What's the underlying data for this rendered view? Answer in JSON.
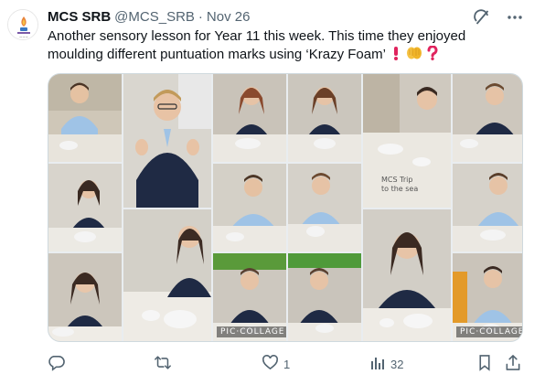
{
  "author": {
    "display_name": "MCS SRB",
    "handle": "@MCS_SRB",
    "separator": "·",
    "date": "Nov 26"
  },
  "tweet": {
    "line1": "Another sensory lesson for Year 11 this week. This time they enjoyed",
    "line2": "moulding different puntuation marks using ‘Krazy Foam’"
  },
  "media": {
    "watermark": "PIC·COLLAGE",
    "board_text": "MCS Trip to the sea",
    "photo_count": 17
  },
  "actions": {
    "reply_count": "",
    "retweet_count": "",
    "like_count": "1",
    "views_count": "32"
  },
  "icons": [
    "grok-icon",
    "more-icon",
    "reply-icon",
    "retweet-icon",
    "like-icon",
    "views-icon",
    "bookmark-icon",
    "share-icon",
    "exclamation-emoji",
    "hands-emoji",
    "question-emoji"
  ],
  "colors": {
    "text": "#0f1419",
    "secondary": "#536471",
    "border": "#cfd9de",
    "uniform_navy": "#1f2a44",
    "shirt_blue": "#9fc3e6",
    "foam": "#f4f4f4",
    "emoji_red": "#e0245e",
    "emoji_yellow": "#f5c242"
  }
}
